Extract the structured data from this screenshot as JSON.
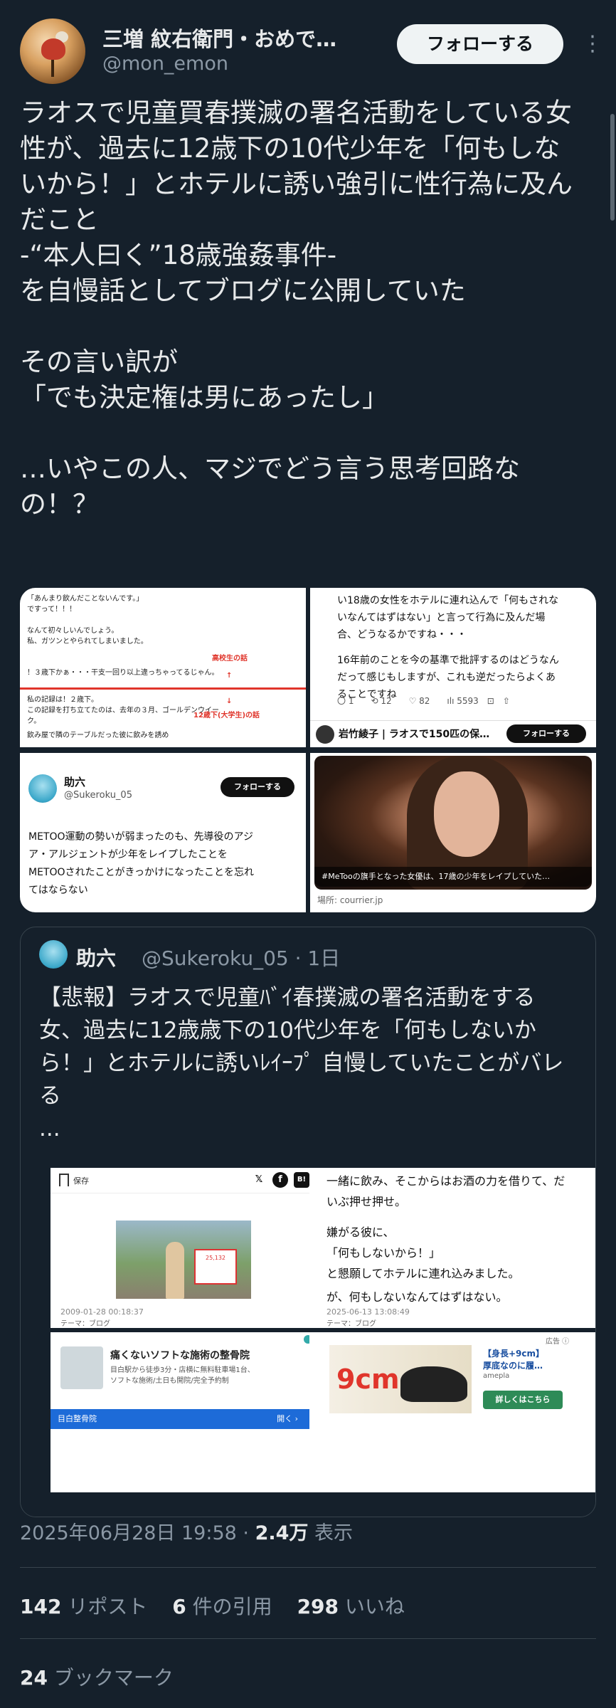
{
  "author": {
    "display_name": "三増 紋右衛門・おめで…",
    "handle": "@mon_emon",
    "follow_label": "フォローする",
    "more_icon": "more-vertical-icon"
  },
  "tweet_lines": [
    "ラオスで児童買春撲滅の署名活動をしている女",
    "性が、過去に12歳下の10代少年を「何もしな",
    "いから！」とホテルに誘い強引に性行為に及ん",
    "だこと",
    "-“本人曰く”18歳強姦事件-",
    "を自慢話としてブログに公開していた",
    "",
    "その言い訳が",
    "「でも決定権は男にあったし」",
    "",
    "…いやこの人、マジでどう言う思考回路な",
    "の！？"
  ],
  "media": {
    "img1": {
      "lines_a": [
        "「あんまり飲んだことないんです。」",
        "ですって！！！",
        "",
        "なんて初々しいんでしょう。",
        "私、ガツンとやられてしまいました。"
      ],
      "line_b": "！３歳下かぁ・・・干支一回り以上違っちゃってるじゃん。",
      "label1": "高校生の話",
      "mark1": "↑",
      "lines_c": [
        "私の記録は！２歳下。",
        "この記録を打ち立てたのは、去年の３月、ゴールデンウイー",
        "ク。"
      ],
      "mark2": "↓",
      "label2": "12歳下(大学生)の話",
      "line_d": "飲み屋で隣のテーブルだった彼に飲みを誘め"
    },
    "img2": {
      "lines": [
        "い18歳の女性をホテルに連れ込んで「何もされな",
        "いなんてはずはない」と言って行為に及んだ場",
        "合、どうなるかですね・・・",
        "",
        "16年前のことを今の基準で批評するのはどうなん",
        "だって感じもしますが、これも逆だったらよくあ",
        "ることですね"
      ],
      "stats": "〇 1　　⟲ 12　　♡ 82　　ılı 5593　⊡　⇧",
      "author": "岩竹綾子 | ラオスで150匹の保…",
      "follow": "フォローする"
    },
    "img3": {
      "name": "助六",
      "handle": "@Sukeroku_05",
      "follow": "フォローする",
      "lines": [
        "METOO運動の勢いが弱まったのも、先導役のアジ",
        "ア・アルジェントが少年をレイプしたことを",
        "METOOされたことがきっかけになったことを忘れ",
        "てはならない"
      ]
    },
    "img4": {
      "caption": "#MeTooの旗手となった女優は、17歳の少年をレイプしていた…",
      "source": "場所: courrier.jp"
    }
  },
  "quote": {
    "name": "助六",
    "meta": "@Sukeroku_05 · 1日",
    "lines": [
      "【悲報】ラオスで児童ﾊﾞｲ春撲滅の署名活動をする",
      "女、過去に12歳歳下の10代少年を「何もしないか",
      "ら！」とホテルに誘いﾚｲｰﾌﾟ 自慢していたことがバレ",
      "る",
      "..."
    ],
    "m1": {
      "save_label": "保存",
      "x_icon": "𝕏",
      "fb_icon": "f",
      "hb_icon": "B!",
      "sign_text": "25,132",
      "date": "2009-01-28 00:18:37",
      "theme": "テーマ：ブログ"
    },
    "m2": {
      "lines": [
        "一緒に飲み、そこからはお酒の力を借りて、だ",
        "いぶ押せ押せ。",
        "",
        "嫌がる彼に、",
        "「何もしないから！」",
        "と懇願してホテルに連れ込みました。",
        "",
        "が、何もしないなんてはずはない。"
      ],
      "date": "2025-06-13 13:08:49",
      "theme": "テーマ：ブログ"
    },
    "m3": {
      "title": "痛くないソフトな施術の整骨院",
      "desc1": "目白駅から徒歩3分・店横に無料駐車場1台、",
      "desc2": "ソフトな施術/土日も開院/完全予約制",
      "bar": "目白整骨院",
      "open": "開く ›"
    },
    "m4": {
      "ad_tag": "広告 ⓘ",
      "nine": "9cm",
      "title1": "【身長+9cm】",
      "title2": "厚底なのに履…",
      "source": "amepla",
      "cta": "詳しくはこちら"
    }
  },
  "timestamp": {
    "datetime": "2025年06月28日 19:58",
    "sep": " · ",
    "views": "2.4万",
    "views_label": " 表示"
  },
  "stats": {
    "reposts": "142",
    "reposts_label": " リポスト",
    "quotes": "6",
    "quotes_label": " 件の引用",
    "likes": "298",
    "likes_label": " いいね"
  },
  "bookmarks": {
    "count": "24",
    "label": " ブックマーク"
  }
}
